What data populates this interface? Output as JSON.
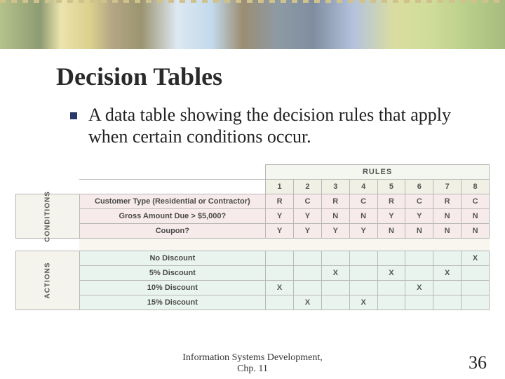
{
  "title": "Decision Tables",
  "bullet": "A data table showing the decision rules that apply when certain conditions occur.",
  "table": {
    "rules_label": "RULES",
    "conditions_label": "CONDITIONS",
    "actions_label": "ACTIONS",
    "rule_numbers": [
      "1",
      "2",
      "3",
      "4",
      "5",
      "6",
      "7",
      "8"
    ],
    "conditions": [
      {
        "label": "Customer Type (Residential or Contractor)",
        "values": [
          "R",
          "C",
          "R",
          "C",
          "R",
          "C",
          "R",
          "C"
        ]
      },
      {
        "label": "Gross Amount Due > $5,000?",
        "values": [
          "Y",
          "Y",
          "N",
          "N",
          "Y",
          "Y",
          "N",
          "N"
        ]
      },
      {
        "label": "Coupon?",
        "values": [
          "Y",
          "Y",
          "Y",
          "Y",
          "N",
          "N",
          "N",
          "N"
        ]
      }
    ],
    "actions": [
      {
        "label": "No Discount",
        "values": [
          "",
          "",
          "",
          "",
          "",
          "",
          "",
          "X"
        ]
      },
      {
        "label": "5% Discount",
        "values": [
          "",
          "",
          "X",
          "",
          "X",
          "",
          "X",
          ""
        ]
      },
      {
        "label": "10% Discount",
        "values": [
          "X",
          "",
          "",
          "",
          "",
          "X",
          "",
          ""
        ]
      },
      {
        "label": "15% Discount",
        "values": [
          "",
          "X",
          "",
          "X",
          "",
          "",
          "",
          ""
        ]
      }
    ]
  },
  "footer": {
    "source_l1": "Information Systems Development,",
    "source_l2": "Chp. 11",
    "page": "36"
  }
}
